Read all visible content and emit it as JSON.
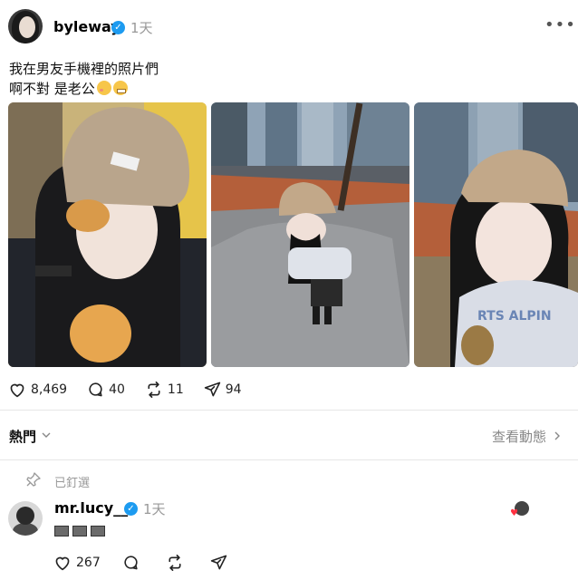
{
  "post": {
    "username": "byleway",
    "time": "1天",
    "caption_line1": "我在男友手機裡的照片們",
    "caption_line2": "啊不對 是老公",
    "stats": {
      "likes": "8,469",
      "comments": "40",
      "reposts": "11",
      "shares": "94"
    }
  },
  "section": {
    "hot_label": "熱門",
    "view_activity": "查看動態"
  },
  "pinned_reply": {
    "pinned_label": "已釘選",
    "username": "mr.lucy__",
    "time": "1天",
    "likes": "267"
  },
  "colors": {
    "verified": "#1d9bf0",
    "heart": "#ff3040",
    "muted_text": "#999999"
  },
  "icons": [
    "more-icon",
    "heart-icon",
    "comment-icon",
    "repost-icon",
    "share-icon",
    "chevron-down-icon",
    "chevron-right-icon",
    "pin-icon",
    "verified-icon"
  ]
}
